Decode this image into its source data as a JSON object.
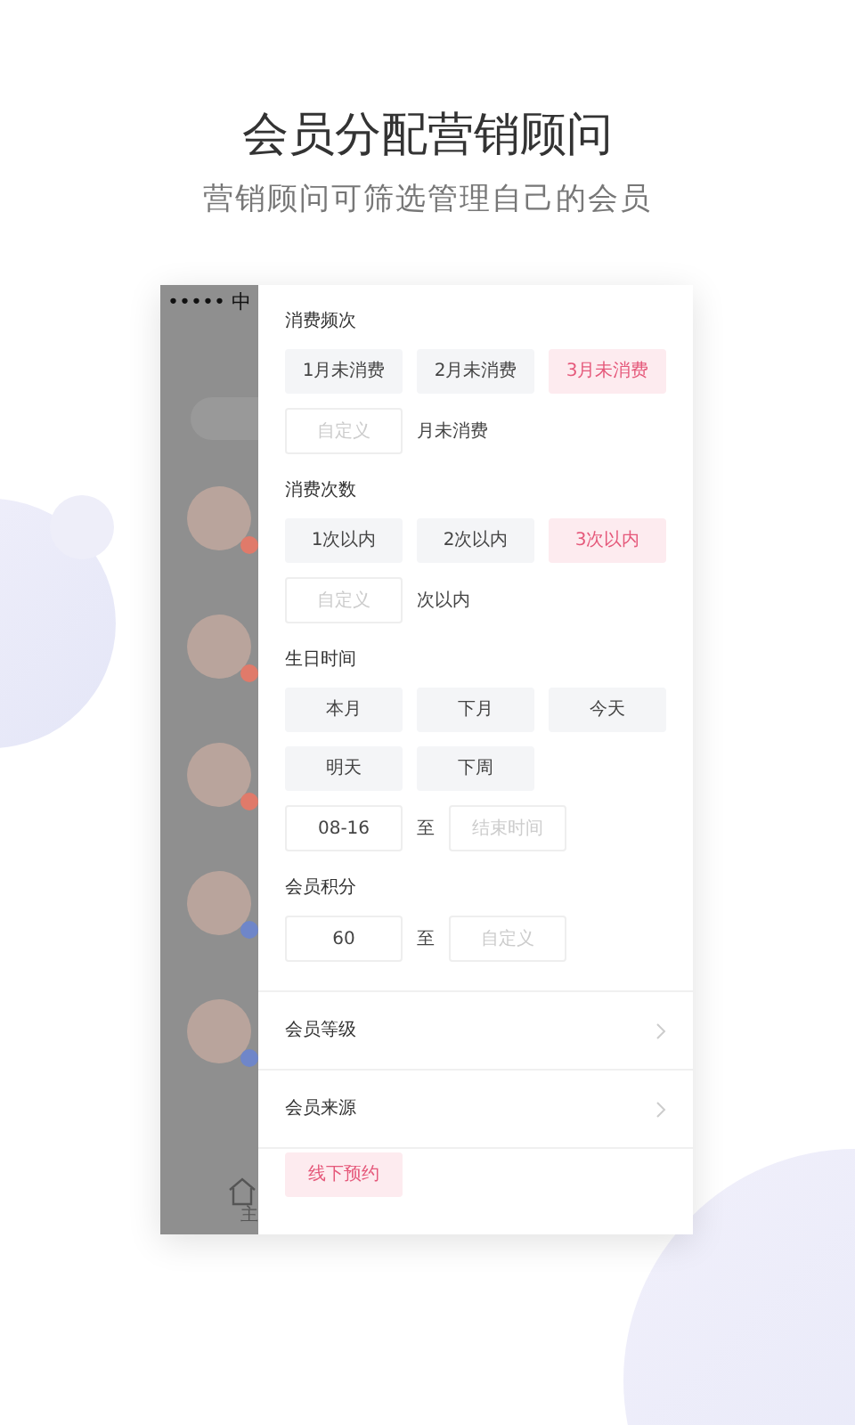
{
  "headline": "会员分配营销顾问",
  "subtitle": "营销顾问可筛选管理自己的会员",
  "background_list": {
    "status_text": "••••• 中",
    "avatars": [
      {
        "color": "#e07a6a"
      },
      {
        "color": "#e07a6a"
      },
      {
        "color": "#e07a6a"
      },
      {
        "color": "#6f86c9"
      },
      {
        "color": "#6f86c9"
      }
    ],
    "tab_label": "主"
  },
  "filter_panel": {
    "sections": [
      {
        "title": "消费频次",
        "kind": "chips",
        "options": [
          {
            "label": "1月未消费",
            "selected": false
          },
          {
            "label": "2月未消费",
            "selected": false
          },
          {
            "label": "3月未消费",
            "selected": true
          }
        ],
        "custom": {
          "placeholder": "自定义",
          "suffix": "月未消费"
        }
      },
      {
        "title": "消费次数",
        "kind": "chips",
        "options": [
          {
            "label": "1次以内",
            "selected": false
          },
          {
            "label": "2次以内",
            "selected": false
          },
          {
            "label": "3次以内",
            "selected": true
          }
        ],
        "custom": {
          "placeholder": "自定义",
          "suffix": "次以内"
        }
      },
      {
        "title": "生日时间",
        "kind": "chips",
        "options": [
          {
            "label": "本月",
            "selected": false
          },
          {
            "label": "下月",
            "selected": false
          },
          {
            "label": "今天",
            "selected": false
          },
          {
            "label": "明天",
            "selected": false
          },
          {
            "label": "下周",
            "selected": false
          }
        ],
        "range": {
          "from": "08-16",
          "separator": "至",
          "to_placeholder": "结束时间"
        }
      },
      {
        "title": "会员积分",
        "kind": "range",
        "range": {
          "from": "60",
          "separator": "至",
          "to_placeholder": "自定义"
        }
      }
    ],
    "rows": [
      {
        "label": "会员等级"
      },
      {
        "label": "会员来源"
      }
    ],
    "source_options": [
      {
        "label": "线下预约",
        "selected": true
      }
    ]
  }
}
